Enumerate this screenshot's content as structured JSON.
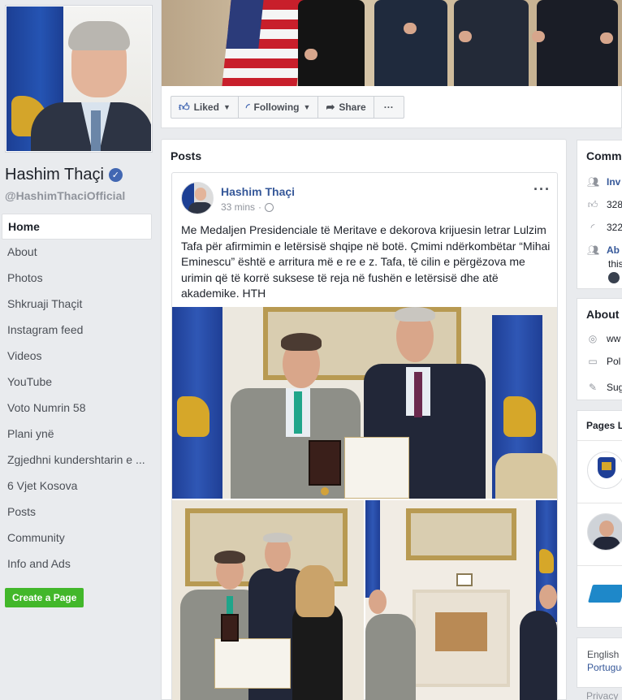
{
  "page": {
    "name": "Hashim Thaçi",
    "handle": "@HashimThaciOfficial"
  },
  "nav": {
    "items": [
      {
        "label": "Home",
        "active": true
      },
      {
        "label": "About"
      },
      {
        "label": "Photos"
      },
      {
        "label": "Shkruaji Thaçit"
      },
      {
        "label": "Instagram feed"
      },
      {
        "label": "Videos"
      },
      {
        "label": "YouTube"
      },
      {
        "label": "Voto Numrin 58"
      },
      {
        "label": "Plani ynë"
      },
      {
        "label": "Zgjedhni kundershtarin e ..."
      },
      {
        "label": "6 Vjet Kosova"
      },
      {
        "label": "Posts"
      },
      {
        "label": "Community"
      },
      {
        "label": "Info and Ads"
      }
    ],
    "create_page": "Create a Page"
  },
  "actions": {
    "liked": "Liked",
    "following": "Following",
    "share": "Share",
    "more": "···"
  },
  "posts": {
    "title": "Posts",
    "post": {
      "author": "Hashim Thaçi",
      "time": "33 mins",
      "text": "Me Medaljen Presidenciale të Meritave e dekorova krijuesin letrar Lulzim Tafa për afirmimin e letërsisë shqipe në botë. Çmimi ndërkombëtar “Mihai Eminescu” është e arritura më e re e z. Tafa, të cilin e përgëzova me urimin që të korrë suksese të reja në fushën e letërsisë dhe atë akademike. HTH"
    }
  },
  "right": {
    "community": {
      "title": "Comm",
      "rows": [
        {
          "icon": "invite-icon",
          "text": "Inv",
          "link": true
        },
        {
          "icon": "like-icon",
          "text": "328"
        },
        {
          "icon": "follow-icon",
          "text": "322"
        },
        {
          "icon": "friends-icon",
          "text": "Ab",
          "sub": "this",
          "link": true
        }
      ]
    },
    "about": {
      "title": "About",
      "rows": [
        {
          "icon": "globe-icon",
          "text": "ww"
        },
        {
          "icon": "page-icon",
          "text": "Pol"
        },
        {
          "icon": "pencil-icon",
          "text": "Sug"
        }
      ]
    },
    "pages_liked": {
      "title": "Pages L"
    },
    "languages": {
      "line1": "English (",
      "line2": "Portugue"
    },
    "footer": "Privacy"
  },
  "colors": {
    "brand_blue": "#4267b2",
    "link_blue": "#365899",
    "green": "#42b72a",
    "background": "#e9ebee"
  }
}
